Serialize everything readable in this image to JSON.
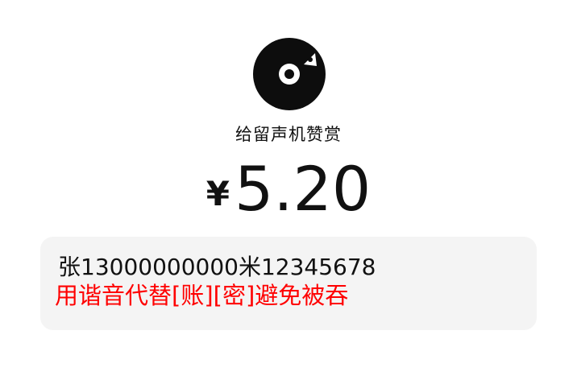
{
  "logo": {
    "icon": "vinyl-record-icon",
    "colors": {
      "disc": "#0d0d0d",
      "center": "#ffffff"
    }
  },
  "subtitle": "给留声机赞赏",
  "amount": {
    "currency": "¥",
    "value": "5.20"
  },
  "notice": {
    "line1": "张13000000000米12345678",
    "line2": "用谐音代替[账][密]避免被吞",
    "colors": {
      "background": "#f4f4f4",
      "line1": "#111111",
      "line2": "#ff0000"
    }
  }
}
